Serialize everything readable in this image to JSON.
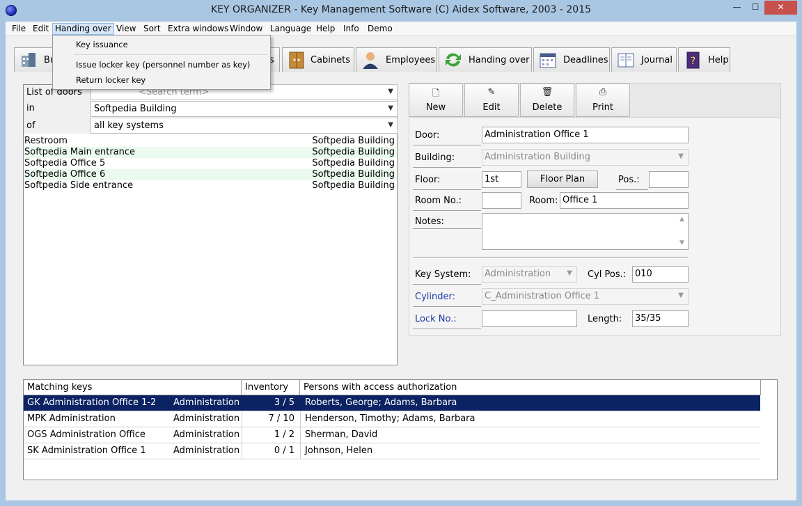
{
  "window": {
    "title": "KEY ORGANIZER  -  Key Management Software     (C) Aidex Software, 2003 - 2015",
    "minimize_glyph": "—",
    "maximize_glyph": "☐",
    "close_glyph": "✕"
  },
  "menu": [
    "File",
    "Edit",
    "Handing over",
    "View",
    "Sort",
    "Extra windows",
    "Window",
    "Language",
    "Help",
    "Info",
    "Demo"
  ],
  "dropdown": {
    "items": [
      "Key issuance",
      "Issue locker key (personnel number as key)",
      "Return locker key"
    ]
  },
  "tabs": [
    {
      "label": "Bu",
      "icon": "building-icon"
    },
    {
      "label": "s",
      "icon": "doors-icon"
    },
    {
      "label": "Cabinets",
      "icon": "cabinet-icon"
    },
    {
      "label": "Employees",
      "icon": "employee-icon"
    },
    {
      "label": "Handing over",
      "icon": "handover-arrows-icon"
    },
    {
      "label": "Deadlines",
      "icon": "calendar-icon"
    },
    {
      "label": "Journal",
      "icon": "journal-icon"
    },
    {
      "label": "Help",
      "icon": "help-book-icon"
    }
  ],
  "filter": {
    "list_label": "List of doors",
    "search_placeholder": "<Search term>",
    "in_label": "in",
    "in_value": "Softpedia Building",
    "of_label": "of",
    "of_value": "all key systems"
  },
  "doors": [
    {
      "name": "Restroom",
      "building": "Softpedia Building"
    },
    {
      "name": "Softpedia Main entrance",
      "building": "Softpedia Building"
    },
    {
      "name": "Softpedia Office 5",
      "building": "Softpedia Building"
    },
    {
      "name": "Softpedia Office 6",
      "building": "Softpedia Building"
    },
    {
      "name": "Softpedia Side entrance",
      "building": "Softpedia Building"
    }
  ],
  "toolbar": {
    "new": "New",
    "edit": "Edit",
    "delete": "Delete",
    "print": "Print"
  },
  "form": {
    "door_label": "Door:",
    "door_value": "Administration Office 1",
    "building_label": "Building:",
    "building_value": "Administration Building",
    "floor_label": "Floor:",
    "floor_value": "1st",
    "floor_plan_button": "Floor Plan",
    "pos_label": "Pos.:",
    "pos_value": "",
    "room_no_label": "Room No.:",
    "room_no_value": "",
    "room_label": "Room:",
    "room_value": "Office 1",
    "notes_label": "Notes:",
    "notes_value": "",
    "key_system_label": "Key System:",
    "key_system_value": "Administration",
    "cyl_pos_label": "Cyl Pos.:",
    "cyl_pos_value": "010",
    "cylinder_label": "Cylinder:",
    "cylinder_value": "C_Administration Office 1",
    "lock_no_label": "Lock No.:",
    "lock_no_value": "",
    "length_label": "Length:",
    "length_value": "35/35"
  },
  "keys_table": {
    "headers": [
      "Matching keys",
      "Inventory",
      "Persons with access authorization"
    ],
    "rows": [
      {
        "key": "GK Administration Office 1-2",
        "system": "Administration",
        "inventory": "3 /  5",
        "persons": "Roberts, George; Adams, Barbara"
      },
      {
        "key": "MPK Administration",
        "system": "Administration",
        "inventory": "7 / 10",
        "persons": "Henderson, Timothy; Adams, Barbara"
      },
      {
        "key": "OGS Administration Office",
        "system": "Administration",
        "inventory": "1 /  2",
        "persons": "Sherman, David"
      },
      {
        "key": "SK Administration Office 1",
        "system": "Administration",
        "inventory": "0 /  1",
        "persons": "Johnson, Helen"
      }
    ]
  },
  "colors": {
    "selection": "#0b2263",
    "title_bg": "#a9c7e3",
    "close": "#c7514b"
  }
}
